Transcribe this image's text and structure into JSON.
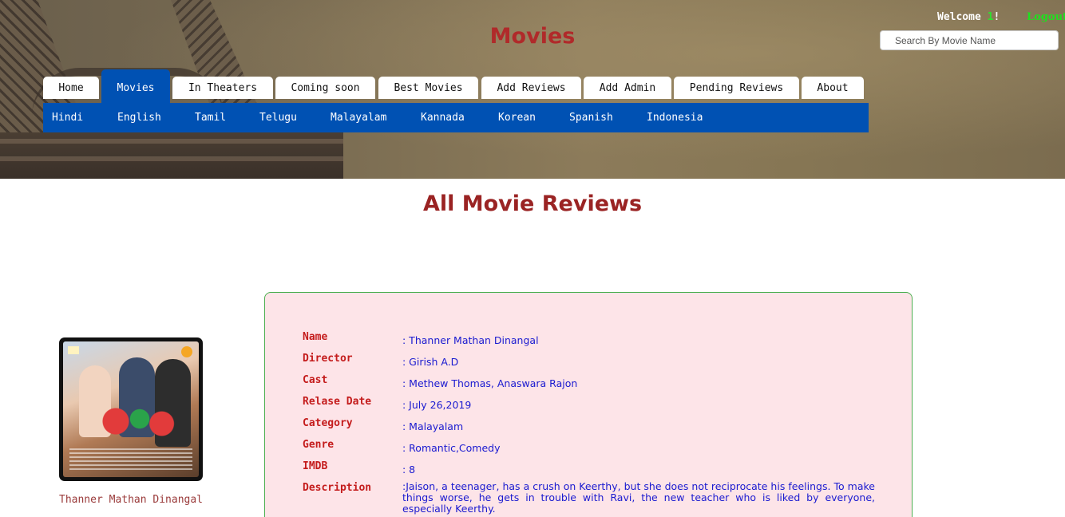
{
  "header": {
    "site_title": "Movies",
    "welcome_prefix": "Welcome ",
    "username": "1",
    "welcome_suffix": "!",
    "logout_label": "Logout",
    "search_placeholder": "Search By Movie Name"
  },
  "main_nav": [
    {
      "label": "Home",
      "active": false
    },
    {
      "label": "Movies",
      "active": true
    },
    {
      "label": "In Theaters",
      "active": false
    },
    {
      "label": "Coming soon",
      "active": false
    },
    {
      "label": "Best Movies",
      "active": false
    },
    {
      "label": "Add Reviews",
      "active": false
    },
    {
      "label": "Add Admin",
      "active": false
    },
    {
      "label": "Pending Reviews",
      "active": false
    },
    {
      "label": "About",
      "active": false
    }
  ],
  "sub_nav": [
    "Hindi",
    "English",
    "Tamil",
    "Telugu",
    "Malayalam",
    "Kannada",
    "Korean",
    "Spanish",
    "Indonesia"
  ],
  "page_heading": "All Movie Reviews",
  "movie": {
    "caption": "Thanner Mathan Dinangal",
    "fields": [
      {
        "label": "Name",
        "value": ": Thanner Mathan Dinangal"
      },
      {
        "label": "Director",
        "value": ": Girish A.D"
      },
      {
        "label": "Cast",
        "value": ": Methew Thomas, Anaswara Rajon"
      },
      {
        "label": "Relase Date",
        "value": ": July 26,2019"
      },
      {
        "label": "Category",
        "value": ": Malayalam"
      },
      {
        "label": "Genre",
        "value": ": Romantic,Comedy"
      },
      {
        "label": "IMDB",
        "value": ": 8"
      },
      {
        "label": "Description",
        "value": ":Jaison, a teenager, has a crush on Keerthy, but she does not reciprocate his feelings. To make things worse, he gets in trouble with Ravi, the new teacher who is liked by everyone, especially Keerthy."
      }
    ]
  },
  "colors": {
    "title_red": "#b02a2a",
    "nav_blue": "#0051b3",
    "card_bg": "#fde4e8",
    "card_border": "#4caf50",
    "label_red": "#c41c1c",
    "value_blue": "#1a1ad0",
    "logout_green": "#1fe01f"
  }
}
